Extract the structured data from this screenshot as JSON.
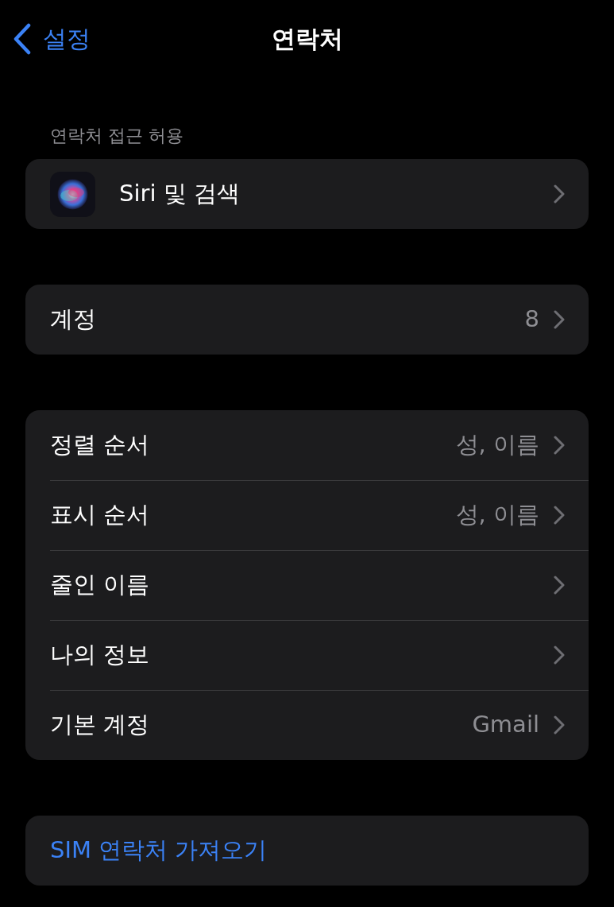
{
  "nav": {
    "back_label": "설정",
    "title": "연락처"
  },
  "sections": [
    {
      "header": "연락처 접근 허용",
      "rows": [
        {
          "kind": "app",
          "label": "Siri 및 검색"
        }
      ]
    },
    {
      "rows": [
        {
          "kind": "nav",
          "label": "계정",
          "value": "8"
        }
      ]
    },
    {
      "rows": [
        {
          "kind": "nav",
          "label": "정렬 순서",
          "value": "성, 이름"
        },
        {
          "kind": "nav",
          "label": "표시 순서",
          "value": "성, 이름"
        },
        {
          "kind": "nav",
          "label": "줄인 이름"
        },
        {
          "kind": "nav",
          "label": "나의 정보"
        },
        {
          "kind": "nav",
          "label": "기본 계정",
          "value": "Gmail"
        }
      ]
    },
    {
      "rows": [
        {
          "kind": "action",
          "label": "SIM 연락처 가져오기"
        }
      ]
    }
  ]
}
